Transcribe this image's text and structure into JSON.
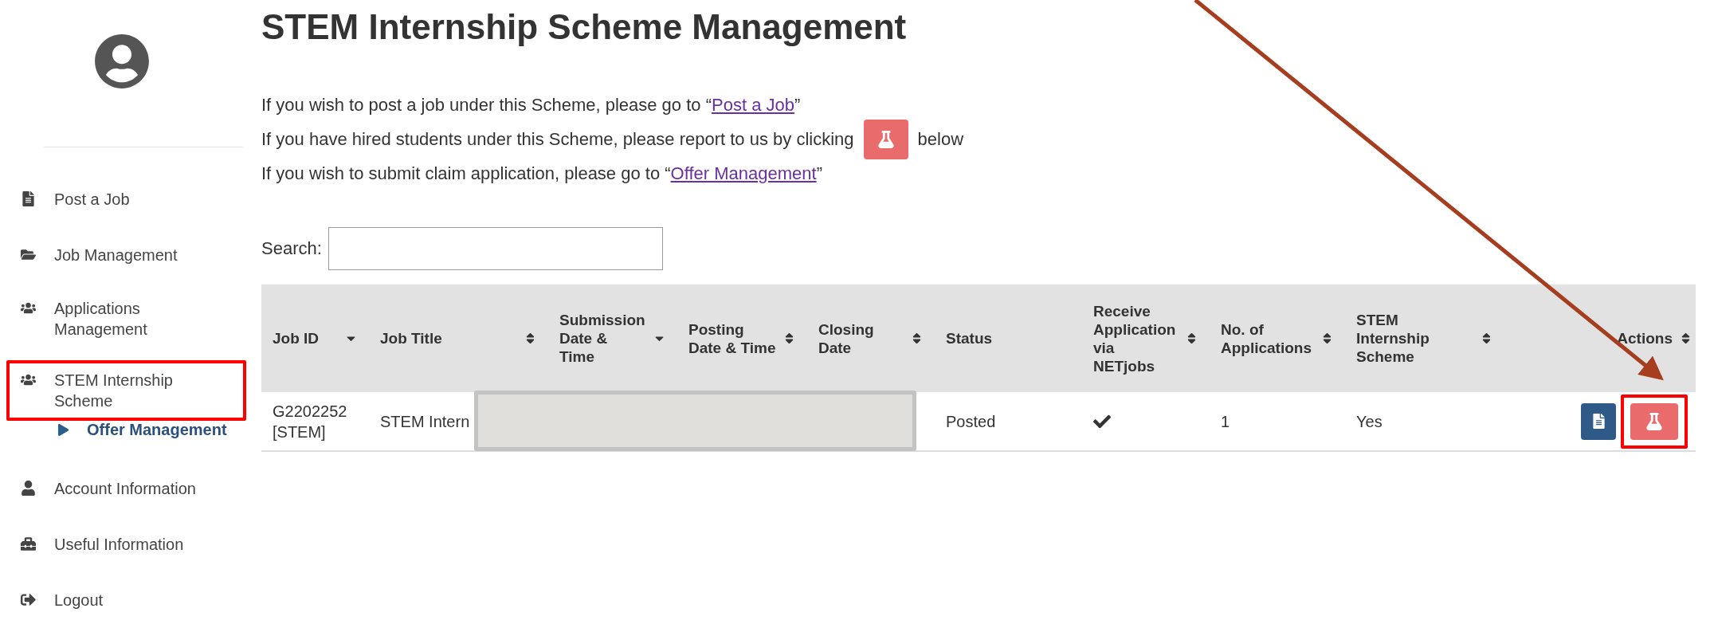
{
  "sidebar": {
    "items": [
      {
        "label": "Post a Job",
        "kind": "file",
        "selected": false,
        "highlighted": false
      },
      {
        "label": "Job Management",
        "kind": "folder",
        "selected": false,
        "highlighted": false
      },
      {
        "label": "Applications Management",
        "kind": "users",
        "selected": false,
        "highlighted": false
      },
      {
        "label": "STEM Internship Scheme",
        "kind": "users",
        "selected": false,
        "highlighted": true,
        "children": [
          {
            "label": "Offer Management",
            "kind": "play",
            "selected": true,
            "highlighted": false
          }
        ]
      },
      {
        "label": "Account Information",
        "kind": "user",
        "selected": false,
        "highlighted": false
      },
      {
        "label": "Useful Information",
        "kind": "toolbox",
        "selected": false,
        "highlighted": false
      },
      {
        "label": "Logout",
        "kind": "logout",
        "selected": false,
        "highlighted": false
      }
    ]
  },
  "page": {
    "title": "STEM Internship Scheme Management",
    "intro": [
      [
        {
          "kind": "text",
          "text": "If you wish to post a job under this Scheme, please go to “"
        },
        {
          "kind": "link",
          "text": "Post a Job"
        },
        {
          "kind": "text",
          "text": "”"
        }
      ],
      [
        {
          "kind": "text",
          "text": "If you have hired students under this Scheme, please report to us by clicking"
        },
        {
          "kind": "flask-button"
        },
        {
          "kind": "text",
          "text": "below"
        }
      ],
      [
        {
          "kind": "text",
          "text": "If you wish to submit claim application, please go to “"
        },
        {
          "kind": "link",
          "text": "Offer Management"
        },
        {
          "kind": "text",
          "text": "”"
        }
      ]
    ],
    "search": {
      "label": "Search:"
    }
  },
  "table": {
    "columns": [
      {
        "label": "Job ID",
        "sorted": true
      },
      {
        "label": "Job Title",
        "sorted": false
      },
      {
        "label": "Submission Date & Time",
        "sorted": true
      },
      {
        "label": "Posting Date & Time",
        "sorted": false
      },
      {
        "label": "Closing Date",
        "sorted": false
      },
      {
        "label": "Status"
      },
      {
        "label": "Receive Application via NETjobs",
        "sorted": false
      },
      {
        "label": "No. of Applications",
        "sorted": false
      },
      {
        "label": "STEM Internship Scheme",
        "sorted": false
      },
      {
        "label": "Actions",
        "sorted": false
      }
    ],
    "rows": [
      {
        "job_id": "G2202252 [STEM]",
        "job_title": "STEM Intern",
        "redacted": true,
        "status": "Posted",
        "receive_via_netjobs": true,
        "applications": "1",
        "stem_scheme": "Yes",
        "actions": [
          {
            "kind": "view",
            "highlighted": false
          },
          {
            "kind": "report",
            "highlighted": true
          }
        ]
      }
    ]
  }
}
